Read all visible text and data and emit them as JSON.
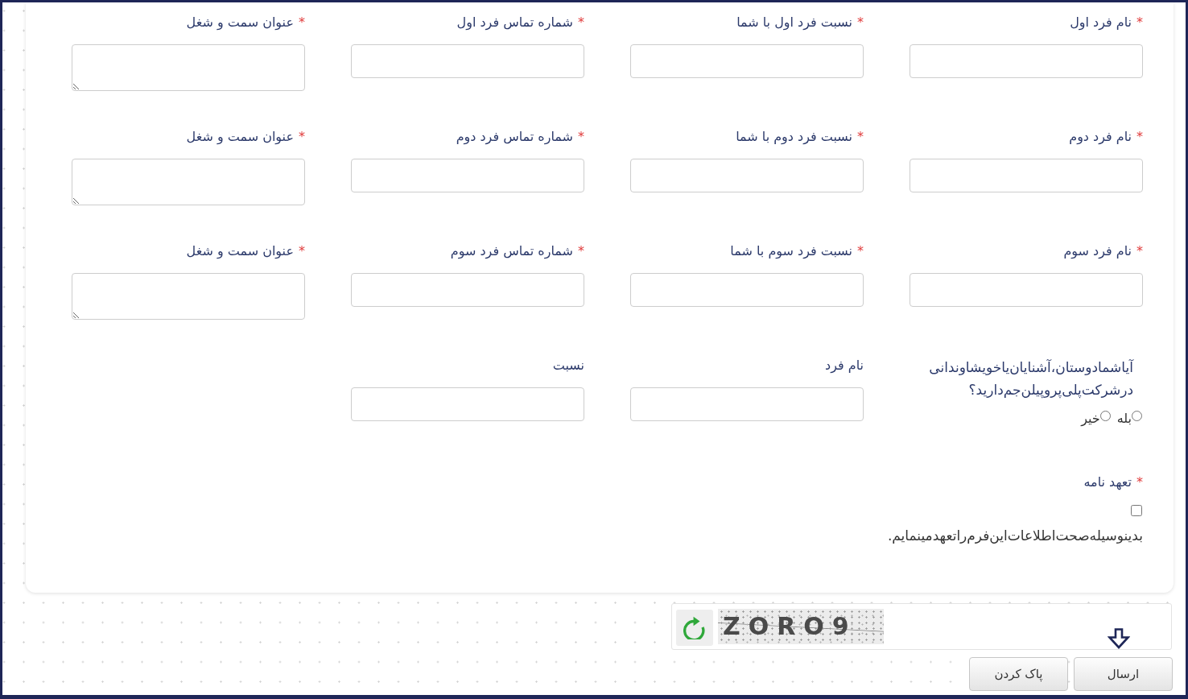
{
  "rows": [
    {
      "fields": [
        {
          "kind": "input",
          "required_mark": "*",
          "label": "نام فرد اول"
        },
        {
          "kind": "input",
          "required_mark": "*",
          "label": "نسبت فرد اول با شما"
        },
        {
          "kind": "input",
          "required_mark": "*",
          "label": "شماره تماس فرد اول"
        },
        {
          "kind": "textarea",
          "required_mark": "*",
          "label": "عنوان سمت و شغل"
        }
      ]
    },
    {
      "fields": [
        {
          "kind": "input",
          "required_mark": "*",
          "label": "نام فرد دوم"
        },
        {
          "kind": "input",
          "required_mark": "*",
          "label": "نسبت فرد دوم با شما"
        },
        {
          "kind": "input",
          "required_mark": "*",
          "label": "شماره تماس فرد دوم"
        },
        {
          "kind": "textarea",
          "required_mark": "*",
          "label": "عنوان سمت و شغل"
        }
      ]
    },
    {
      "fields": [
        {
          "kind": "input",
          "required_mark": "*",
          "label": "نام فرد سوم"
        },
        {
          "kind": "input",
          "required_mark": "*",
          "label": "نسبت فرد سوم با شما"
        },
        {
          "kind": "input",
          "required_mark": "*",
          "label": "شماره تماس فرد سوم"
        },
        {
          "kind": "textarea",
          "required_mark": "*",
          "label": "عنوان سمت و شغل"
        }
      ]
    },
    {
      "fields": [
        {
          "kind": "radio_group",
          "label": "آیاشمادوستان،آشنایان‌یاخویشاوندانی درشرکت‌پلی‌پروپیلن‌جم‌دارید؟",
          "options": [
            {
              "label": "بله",
              "selected": false
            },
            {
              "label": "خیر",
              "selected": false
            }
          ]
        },
        {
          "kind": "input",
          "label": "نام فرد"
        },
        {
          "kind": "input",
          "label": "نسبت"
        }
      ]
    }
  ],
  "commitment": {
    "required_mark": "*",
    "label": "تعهد نامه",
    "checked": false,
    "text": "بدینوسیله‌صحت‌اطلاعات‌این‌فرم‌راتعهدمینمایم."
  },
  "captcha": {
    "code": "ZORO9"
  },
  "buttons": [
    {
      "label": "ارسال"
    },
    {
      "label": "پاک کردن"
    }
  ]
}
